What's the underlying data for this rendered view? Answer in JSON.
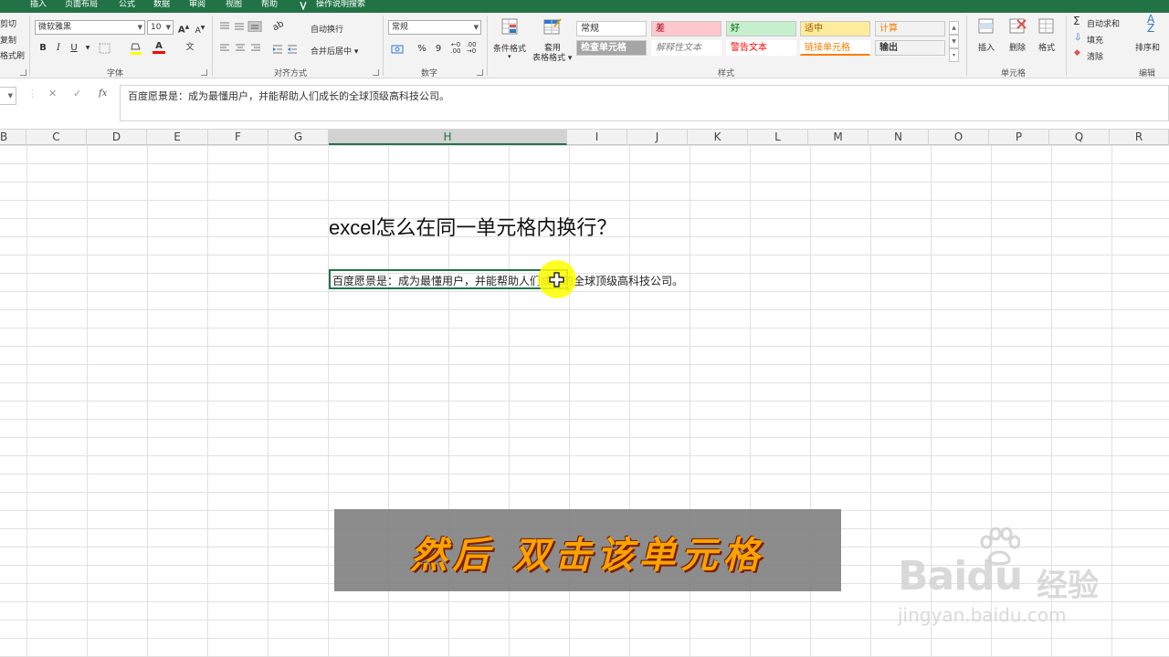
{
  "tabs": [
    "插入",
    "页面布局",
    "公式",
    "数据",
    "审阅",
    "视图",
    "帮助",
    "操作说明搜索"
  ],
  "clipboard": {
    "cut": "剪切",
    "copy": "复制",
    "format_painter": "格式刷"
  },
  "font": {
    "name": "微软雅黑",
    "size": "10",
    "bold": "B",
    "italic": "I",
    "underline": "U",
    "grow": "A",
    "shrink": "A",
    "color_letter": "A",
    "phonetic": "文",
    "group_label": "字体"
  },
  "alignment": {
    "wrap": "自动换行",
    "merge": "合并后居中",
    "group_label": "对齐方式"
  },
  "number": {
    "format": "常规",
    "percent": "%",
    "comma": "9",
    "group_label": "数字"
  },
  "styles": {
    "cond_format": "条件格式",
    "table_format_1": "套用",
    "table_format_2": "表格格式",
    "cells": [
      {
        "label": "常规",
        "bg": "#ffffff",
        "fg": "#333333"
      },
      {
        "label": "差",
        "bg": "#ffc7ce",
        "fg": "#9c0006"
      },
      {
        "label": "好",
        "bg": "#c6efce",
        "fg": "#006100"
      },
      {
        "label": "适中",
        "bg": "#ffeb9c",
        "fg": "#9c5700"
      },
      {
        "label": "计算",
        "bg": "#f2f2f2",
        "fg": "#fa7d00"
      },
      {
        "label": "检查单元格",
        "bg": "#a5a5a5",
        "fg": "#ffffff"
      },
      {
        "label": "解释性文本",
        "bg": "#ffffff",
        "fg": "#7f7f7f"
      },
      {
        "label": "警告文本",
        "bg": "#ffffff",
        "fg": "#ff0000"
      },
      {
        "label": "链接单元格",
        "bg": "#ffffff",
        "fg": "#fa7d00"
      },
      {
        "label": "输出",
        "bg": "#f2f2f2",
        "fg": "#3f3f3f"
      }
    ],
    "group_label": "样式"
  },
  "cells_group": {
    "insert": "插入",
    "delete": "删除",
    "format": "格式",
    "group_label": "单元格"
  },
  "editing": {
    "autosum": "自动求和",
    "fill": "填充",
    "clear": "清除",
    "sort": "排序和",
    "group_label": "编辑"
  },
  "formula": {
    "value": "百度愿景是：成为最懂用户，并能帮助人们成长的全球顶级高科技公司。",
    "fx": "fx"
  },
  "columns": [
    "B",
    "C",
    "D",
    "E",
    "F",
    "G",
    "H",
    "I",
    "J",
    "K",
    "L",
    "M",
    "N",
    "O",
    "P",
    "Q",
    "R"
  ],
  "sheet": {
    "title": "excel怎么在同一单元格内换行？",
    "cell_value": "百度愿景是：成为最懂用户，并能帮助人们成长的全球顶级高科技公司。"
  },
  "caption": "然后 双击该单元格",
  "watermark": {
    "logo": "Baidu",
    "jingyan": "经验",
    "url": "jingyan.baidu.com"
  },
  "colors": {
    "accent": "#217346",
    "caption_text": "#f8a300"
  }
}
